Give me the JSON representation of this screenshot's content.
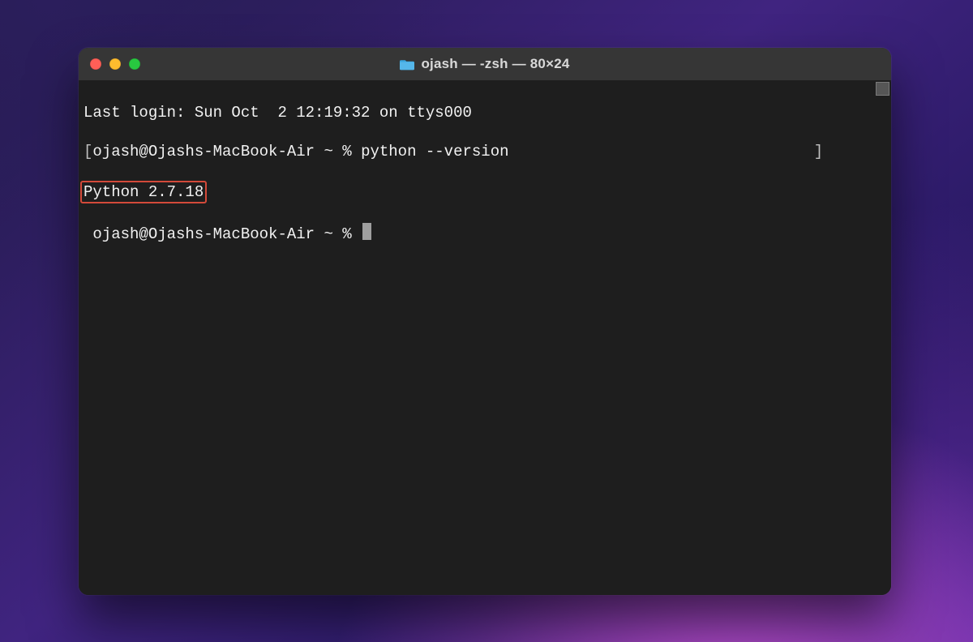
{
  "window": {
    "title": "ojash — -zsh — 80×24"
  },
  "terminal": {
    "last_login": "Last login: Sun Oct  2 12:19:32 on ttys000",
    "prompt1_open": "[",
    "prompt1_text": "ojash@Ojashs-MacBook-Air ~ % ",
    "command1": "python --version",
    "prompt1_close": "]",
    "output1": "Python 2.7.18",
    "prompt2_text": "ojash@Ojashs-MacBook-Air ~ % "
  },
  "icons": {
    "folder": "folder-icon"
  },
  "colors": {
    "window_bg": "#1e1e1e",
    "titlebar_bg": "#363636",
    "text": "#f2f2f2",
    "highlight_border": "#d34a3a",
    "traffic_close": "#ff5f57",
    "traffic_min": "#febc2e",
    "traffic_zoom": "#28c840"
  }
}
